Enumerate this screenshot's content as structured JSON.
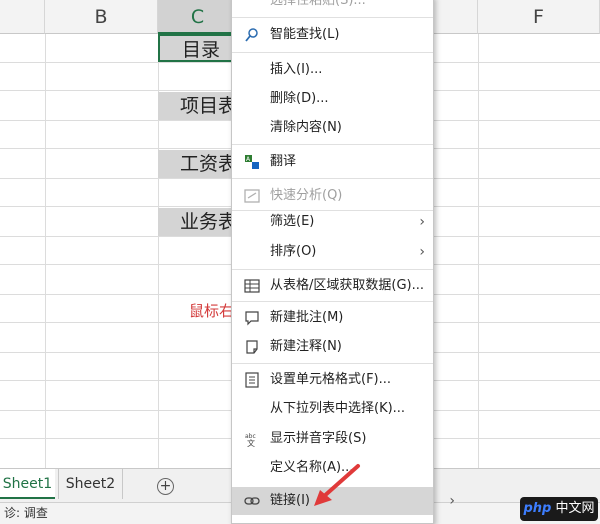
{
  "grid": {
    "columns": [
      {
        "key": "B",
        "label": "B",
        "selected": false
      },
      {
        "key": "C",
        "label": "C",
        "selected": true
      },
      {
        "key": "F",
        "label": "F",
        "selected": false
      }
    ],
    "cells_c": [
      "目录",
      "项目表",
      "工资表",
      "业务表"
    ]
  },
  "annotation": "鼠标右键",
  "context_menu": {
    "items": [
      {
        "label": "选择性粘贴(S)...",
        "icon": "paste-special-icon",
        "disabled": true,
        "partial": true
      },
      {
        "label": "智能查找(L)",
        "icon": "smart-lookup-icon",
        "disabled": false
      },
      {
        "label": "插入(I)...",
        "icon": "",
        "disabled": false
      },
      {
        "label": "删除(D)...",
        "icon": "",
        "disabled": false
      },
      {
        "label": "清除内容(N)",
        "icon": "",
        "disabled": false
      },
      {
        "label": "翻译",
        "icon": "translate-icon",
        "disabled": false
      },
      {
        "label": "快速分析(Q)",
        "icon": "quick-analysis-icon",
        "disabled": true
      },
      {
        "label": "筛选(E)",
        "icon": "",
        "disabled": false,
        "submenu": true
      },
      {
        "label": "排序(O)",
        "icon": "",
        "disabled": false,
        "submenu": true
      },
      {
        "label": "从表格/区域获取数据(G)...",
        "icon": "table-icon",
        "disabled": false
      },
      {
        "label": "新建批注(M)",
        "icon": "new-comment-icon",
        "disabled": false
      },
      {
        "label": "新建注释(N)",
        "icon": "new-note-icon",
        "disabled": false
      },
      {
        "label": "设置单元格格式(F)...",
        "icon": "format-cells-icon",
        "disabled": false
      },
      {
        "label": "从下拉列表中选择(K)...",
        "icon": "",
        "disabled": false
      },
      {
        "label": "显示拼音字段(S)",
        "icon": "phonetic-icon",
        "disabled": false
      },
      {
        "label": "定义名称(A)...",
        "icon": "",
        "disabled": false
      },
      {
        "label": "链接(I)",
        "icon": "link-icon",
        "disabled": false,
        "submenu": true,
        "highlighted": true
      }
    ]
  },
  "sheet_tabs": [
    "Sheet1",
    "Sheet2"
  ],
  "add_sheet_symbol": "+",
  "status_bar": {
    "text": "诊: 调查"
  },
  "watermark": {
    "brand": "php",
    "site": "中文网"
  },
  "colors": {
    "accent": "#217346",
    "annotation": "#d33b3b",
    "menu_highlight": "#d6d6d6"
  }
}
